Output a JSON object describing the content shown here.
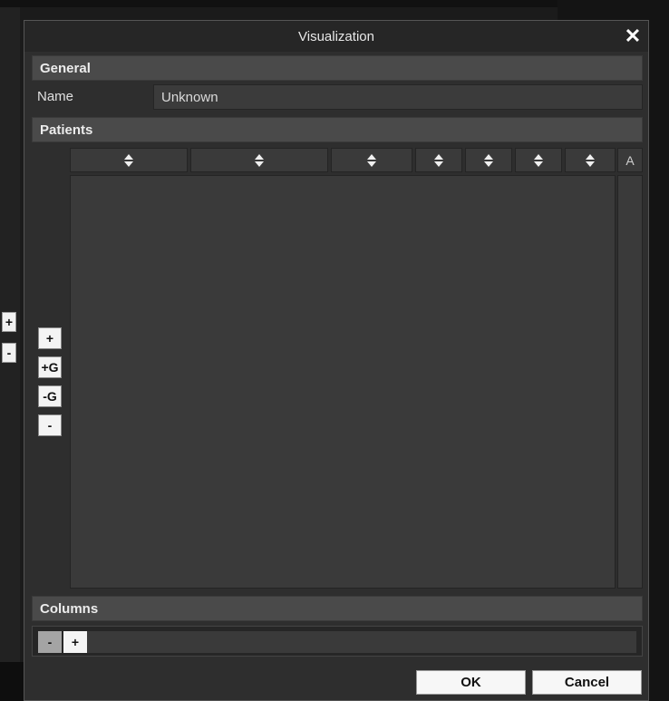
{
  "dialog": {
    "title": "Visualization",
    "close_icon": "close-icon"
  },
  "general": {
    "header": "General",
    "name_label": "Name",
    "name_value": "Unknown"
  },
  "patients": {
    "header": "Patients",
    "columns": [
      {
        "icon": "sort-icon"
      },
      {
        "icon": "sort-icon"
      },
      {
        "icon": "sort-icon"
      },
      {
        "icon": "sort-icon"
      },
      {
        "icon": "sort-icon"
      },
      {
        "icon": "sort-icon"
      },
      {
        "icon": "sort-icon"
      }
    ],
    "extra_column_label": "A",
    "buttons": {
      "add": "+",
      "add_group": "+G",
      "remove_group": "-G",
      "remove": "-"
    }
  },
  "side_panel": {
    "plus": "+",
    "minus": "-"
  },
  "columns_section": {
    "header": "Columns",
    "minus": "-",
    "plus": "+"
  },
  "footer": {
    "ok_label": "OK",
    "cancel_label": "Cancel"
  }
}
